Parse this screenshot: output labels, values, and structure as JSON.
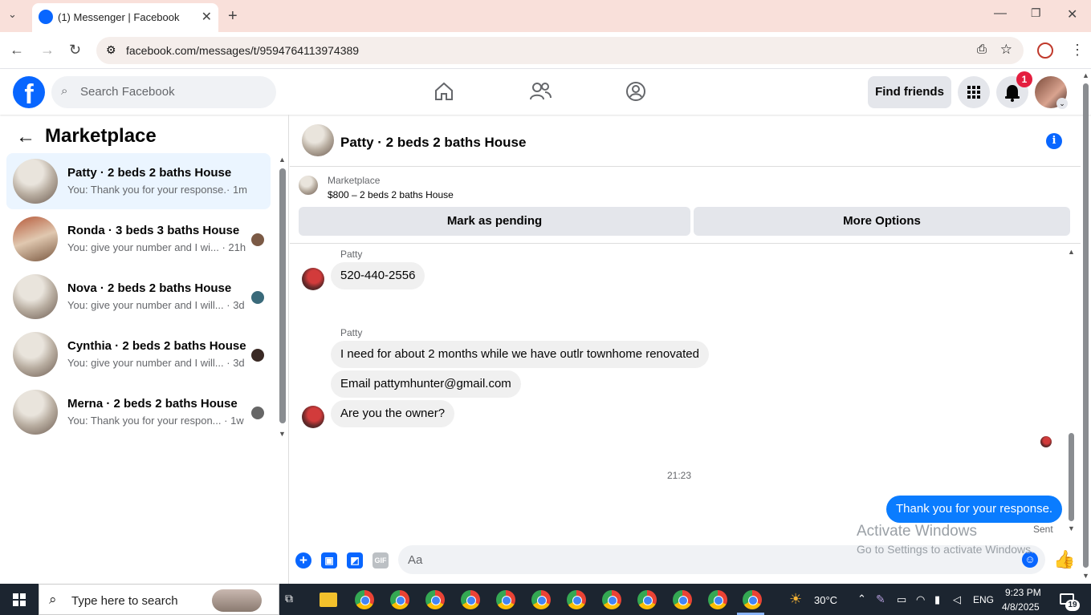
{
  "browser": {
    "tab_title": "(1) Messenger | Facebook",
    "url": "facebook.com/messages/t/9594764113974389"
  },
  "header": {
    "search_placeholder": "Search Facebook",
    "find_friends_label": "Find friends",
    "notification_count": "1",
    "logo_letter": "f"
  },
  "sidebar": {
    "title": "Marketplace",
    "conversations": [
      {
        "name": "Patty · 2 beds 2 baths House",
        "snippet": "You: Thank you for your response.",
        "time": "· 1m",
        "active": true
      },
      {
        "name": "Ronda · 3 beds 3 baths House",
        "snippet": "You: give your number and I wi...",
        "time": "· 21h",
        "active": false
      },
      {
        "name": "Nova · 2 beds 2 baths House",
        "snippet": "You: give your number and I will...",
        "time": "· 3d",
        "active": false
      },
      {
        "name": "Cynthia · 2 beds 2 baths House",
        "snippet": "You: give your number and I will...",
        "time": "· 3d",
        "active": false
      },
      {
        "name": "Merna · 2 beds 2 baths House",
        "snippet": "You: Thank you for your respon...",
        "time": "· 1w",
        "active": false
      }
    ]
  },
  "chat": {
    "title": "Patty · 2 beds 2 baths House",
    "marketplace_label": "Marketplace",
    "listing": "$800 – 2 beds 2 baths House",
    "mark_pending_label": "Mark as pending",
    "more_options_label": "More Options",
    "messages": {
      "sender1": "Patty",
      "msg1": "520-440-2556",
      "sender2": "Patty",
      "msg2": "I need for about 2 months while we have outlr townhome renovated",
      "msg3": "Email pattymhunter@gmail.com",
      "msg4": "Are you the owner?",
      "timestamp": "21:23",
      "outgoing": "Thank you for your response.",
      "status": "Sent"
    },
    "composer_placeholder": "Aa",
    "gif_label": "GIF"
  },
  "watermark": {
    "line1": "Activate Windows",
    "line2": "Go to Settings to activate Windows."
  },
  "taskbar": {
    "search_placeholder": "Type here to search",
    "weather": "30°C",
    "language": "ENG",
    "time": "9:23 PM",
    "date": "4/8/2025",
    "notifications": "19"
  },
  "colors": {
    "accent": "#0866ff",
    "outgoing_bubble": "#0a7cff",
    "tab_strip": "#f9e0da"
  }
}
